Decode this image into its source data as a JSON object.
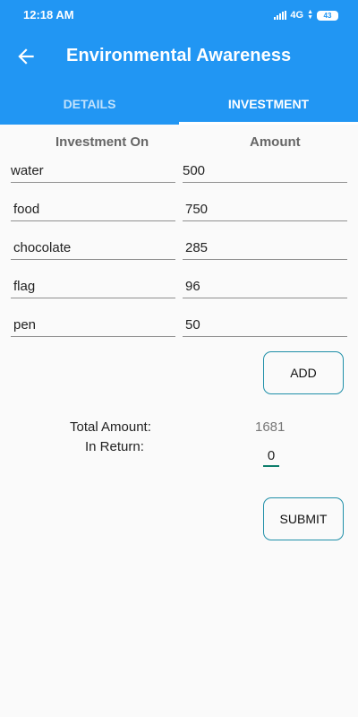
{
  "status_bar": {
    "time": "12:18 AM",
    "network": "4G",
    "battery": "43"
  },
  "app_bar": {
    "title": "Environmental Awareness",
    "back_icon": "arrow-left-icon"
  },
  "tabs": [
    {
      "label": "DETAILS",
      "active": false
    },
    {
      "label": "INVESTMENT",
      "active": true
    }
  ],
  "table": {
    "headers": [
      "Investment On",
      "Amount"
    ],
    "rows": [
      {
        "item": "water",
        "amount": "500"
      },
      {
        "item": "food",
        "amount": "750"
      },
      {
        "item": "chocolate",
        "amount": "285"
      },
      {
        "item": "flag",
        "amount": "96"
      },
      {
        "item": "pen",
        "amount": "50"
      }
    ]
  },
  "add_button": "ADD",
  "total": {
    "label": "Total Amount:",
    "value": "1681"
  },
  "in_return": {
    "label": "In Return:",
    "value": "0"
  },
  "submit_button": "SUBMIT",
  "colors": {
    "primary": "#2196f3",
    "button_border": "#1f8fa8",
    "input_accent": "#0e7e6c",
    "background": "#fafafa"
  }
}
